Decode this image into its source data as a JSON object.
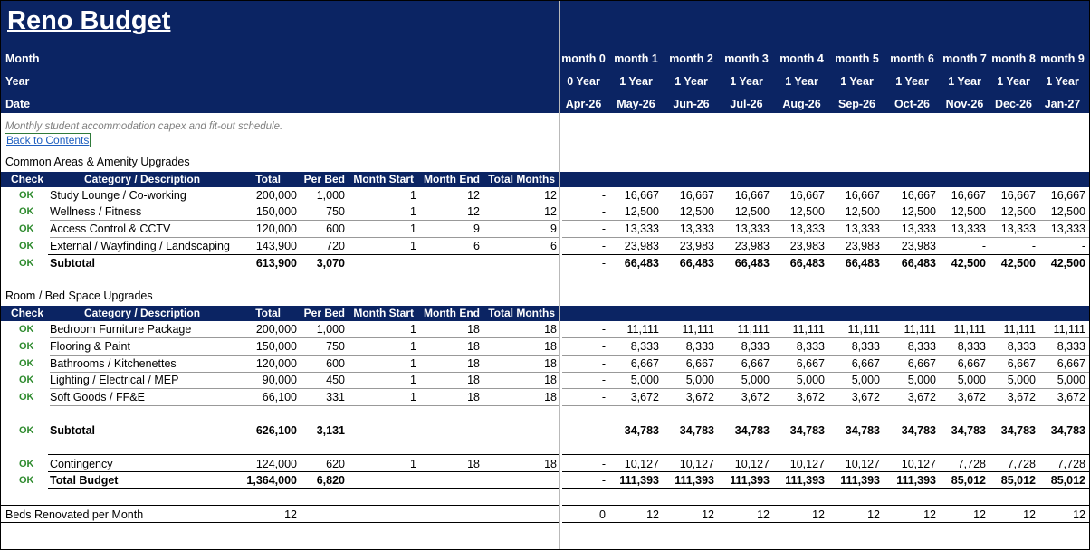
{
  "title": "Reno Budget",
  "header_rows": {
    "month_label": "Month",
    "year_label": "Year",
    "date_label": "Date",
    "months": [
      "month 0",
      "month 1",
      "month 2",
      "month 3",
      "month 4",
      "month 5",
      "month 6",
      "month 7",
      "month 8",
      "month 9"
    ],
    "years": [
      "0 Year",
      "1 Year",
      "1 Year",
      "1 Year",
      "1 Year",
      "1 Year",
      "1 Year",
      "1 Year",
      "1 Year",
      "1 Year"
    ],
    "dates": [
      "Apr-26",
      "May-26",
      "Jun-26",
      "Jul-26",
      "Aug-26",
      "Sep-26",
      "Oct-26",
      "Nov-26",
      "Dec-26",
      "Jan-27"
    ]
  },
  "note": "Monthly student accommodation capex and fit-out schedule.",
  "back_link": "Back to Contents",
  "columns": {
    "check": "Check",
    "category": "Category / Description",
    "total": "Total",
    "per_bed": "Per Bed",
    "month_start": "Month Start",
    "month_end": "Month End",
    "total_months": "Total Months"
  },
  "section1": {
    "title": "Common Areas & Amenity Upgrades",
    "rows": [
      {
        "check": "OK",
        "desc": "Study Lounge / Co-working",
        "total": "200,000",
        "per_bed": "1,000",
        "start": "1",
        "end": "12",
        "months": "12",
        "vals": [
          "-",
          "16,667",
          "16,667",
          "16,667",
          "16,667",
          "16,667",
          "16,667",
          "16,667",
          "16,667",
          "16,667"
        ]
      },
      {
        "check": "OK",
        "desc": "Wellness / Fitness",
        "total": "150,000",
        "per_bed": "750",
        "start": "1",
        "end": "12",
        "months": "12",
        "vals": [
          "-",
          "12,500",
          "12,500",
          "12,500",
          "12,500",
          "12,500",
          "12,500",
          "12,500",
          "12,500",
          "12,500"
        ]
      },
      {
        "check": "OK",
        "desc": "Access Control & CCTV",
        "total": "120,000",
        "per_bed": "600",
        "start": "1",
        "end": "9",
        "months": "9",
        "vals": [
          "-",
          "13,333",
          "13,333",
          "13,333",
          "13,333",
          "13,333",
          "13,333",
          "13,333",
          "13,333",
          "13,333"
        ]
      },
      {
        "check": "OK",
        "desc": "External / Wayfinding / Landscaping",
        "total": "143,900",
        "per_bed": "720",
        "start": "1",
        "end": "6",
        "months": "6",
        "vals": [
          "-",
          "23,983",
          "23,983",
          "23,983",
          "23,983",
          "23,983",
          "23,983",
          "-",
          "-",
          "-"
        ]
      }
    ],
    "subtotal": {
      "check": "OK",
      "desc": "Subtotal",
      "total": "613,900",
      "per_bed": "3,070",
      "vals": [
        "-",
        "66,483",
        "66,483",
        "66,483",
        "66,483",
        "66,483",
        "66,483",
        "42,500",
        "42,500",
        "42,500"
      ]
    }
  },
  "section2": {
    "title": "Room / Bed Space Upgrades",
    "rows": [
      {
        "check": "OK",
        "desc": "Bedroom Furniture Package",
        "total": "200,000",
        "per_bed": "1,000",
        "start": "1",
        "end": "18",
        "months": "18",
        "vals": [
          "-",
          "11,111",
          "11,111",
          "11,111",
          "11,111",
          "11,111",
          "11,111",
          "11,111",
          "11,111",
          "11,111"
        ]
      },
      {
        "check": "OK",
        "desc": "Flooring & Paint",
        "total": "150,000",
        "per_bed": "750",
        "start": "1",
        "end": "18",
        "months": "18",
        "vals": [
          "-",
          "8,333",
          "8,333",
          "8,333",
          "8,333",
          "8,333",
          "8,333",
          "8,333",
          "8,333",
          "8,333"
        ]
      },
      {
        "check": "OK",
        "desc": "Bathrooms / Kitchenettes",
        "total": "120,000",
        "per_bed": "600",
        "start": "1",
        "end": "18",
        "months": "18",
        "vals": [
          "-",
          "6,667",
          "6,667",
          "6,667",
          "6,667",
          "6,667",
          "6,667",
          "6,667",
          "6,667",
          "6,667"
        ]
      },
      {
        "check": "OK",
        "desc": "Lighting / Electrical / MEP",
        "total": "90,000",
        "per_bed": "450",
        "start": "1",
        "end": "18",
        "months": "18",
        "vals": [
          "-",
          "5,000",
          "5,000",
          "5,000",
          "5,000",
          "5,000",
          "5,000",
          "5,000",
          "5,000",
          "5,000"
        ]
      },
      {
        "check": "OK",
        "desc": "Soft Goods / FF&E",
        "total": "66,100",
        "per_bed": "331",
        "start": "1",
        "end": "18",
        "months": "18",
        "vals": [
          "-",
          "3,672",
          "3,672",
          "3,672",
          "3,672",
          "3,672",
          "3,672",
          "3,672",
          "3,672",
          "3,672"
        ]
      }
    ],
    "subtotal": {
      "check": "OK",
      "desc": "Subtotal",
      "total": "626,100",
      "per_bed": "3,131",
      "vals": [
        "-",
        "34,783",
        "34,783",
        "34,783",
        "34,783",
        "34,783",
        "34,783",
        "34,783",
        "34,783",
        "34,783"
      ]
    }
  },
  "contingency": {
    "check": "OK",
    "desc": "Contingency",
    "total": "124,000",
    "per_bed": "620",
    "start": "1",
    "end": "18",
    "months": "18",
    "vals": [
      "-",
      "10,127",
      "10,127",
      "10,127",
      "10,127",
      "10,127",
      "10,127",
      "7,728",
      "7,728",
      "7,728"
    ]
  },
  "total_budget": {
    "check": "OK",
    "desc": "Total Budget",
    "total": "1,364,000",
    "per_bed": "6,820",
    "vals": [
      "-",
      "111,393",
      "111,393",
      "111,393",
      "111,393",
      "111,393",
      "111,393",
      "85,012",
      "85,012",
      "85,012"
    ]
  },
  "beds": {
    "desc": "Beds Renovated per Month",
    "total": "12",
    "vals": [
      "0",
      "12",
      "12",
      "12",
      "12",
      "12",
      "12",
      "12",
      "12",
      "12"
    ]
  },
  "colors": {
    "header_navy": "#0b2463",
    "ok_green": "#2e8b2e",
    "link_blue": "#1f5fbf"
  }
}
